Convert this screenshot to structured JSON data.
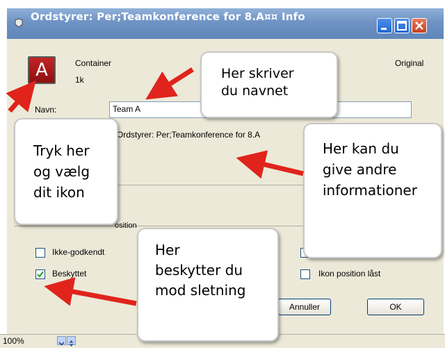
{
  "window": {
    "title": "Ordstyrer: Per;Teamkonference for 8.A¤¤ Info"
  },
  "header": {
    "kind": "Container",
    "size": "1k",
    "status": "Original",
    "icon_letter": "A"
  },
  "form": {
    "name_label": "Navn:",
    "name_value": "Team A",
    "path_value": "Ordstyrer: Per;Teamkonference for 8.A",
    "position_label": "osition"
  },
  "checkboxes": [
    {
      "label": "Ikke-godkendt",
      "checked": false
    },
    {
      "label": "Beskyttet",
      "checked": true
    },
    {
      "label": "Ikon position låst",
      "checked": false
    }
  ],
  "buttons": {
    "cancel": "Annuller",
    "ok": "OK"
  },
  "statusbar": {
    "zoom": "100%"
  },
  "callouts": {
    "name": "Her skriver\ndu navnet",
    "icon": "Tryk her\nog vælg\ndit ikon",
    "info": "Her kan du\ngive andre\ninformationer",
    "protect": "Her\nbeskytter du\nmod sletning"
  },
  "colors": {
    "title_bar": "#6f93c4",
    "window_bg": "#ece9d8",
    "arrow": "#e0241c",
    "icon_red": "#b51b1b"
  }
}
